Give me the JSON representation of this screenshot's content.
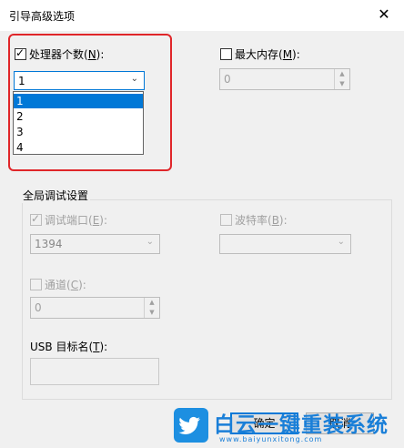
{
  "window": {
    "title": "引导高级选项",
    "close_glyph": "✕"
  },
  "processors": {
    "label_prefix": "处理器个数(",
    "accel": "N",
    "label_suffix": "):",
    "checked": true,
    "selected": "1",
    "options": [
      "1",
      "2",
      "3",
      "4"
    ]
  },
  "memory": {
    "label_prefix": "最大内存(",
    "accel": "M",
    "label_suffix": "):",
    "checked": false,
    "value": "0"
  },
  "debug_group": {
    "title": "全局调试设置",
    "debug_port": {
      "label_prefix": "调试端口(",
      "accel": "E",
      "label_suffix": "):",
      "checked": true,
      "value": "1394"
    },
    "baud_rate": {
      "label_prefix": "波特率(",
      "accel": "B",
      "label_suffix": "):",
      "checked": false,
      "value": ""
    },
    "channel": {
      "label_prefix": "通道(",
      "accel": "C",
      "label_suffix": "):",
      "checked": false,
      "value": "0"
    },
    "usb_target": {
      "label_prefix": "USB 目标名(",
      "accel": "T",
      "label_suffix": "):",
      "value": ""
    }
  },
  "buttons": {
    "ok": "确定",
    "cancel": "取消"
  },
  "watermark": {
    "brand": "白云一键重装系统",
    "url": "www.baiyunxitong.com"
  },
  "colors": {
    "accent": "#0078d7",
    "highlight_box": "#e0262a",
    "dialog_bg": "#f0f0f0"
  }
}
